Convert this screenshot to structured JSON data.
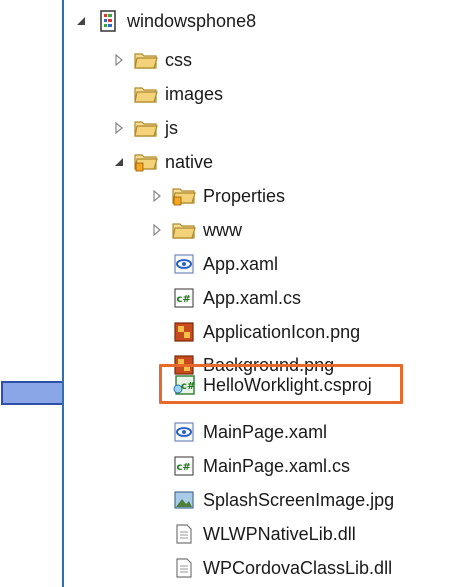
{
  "tree": {
    "root": {
      "label": "windowsphone8",
      "icon": "project-icon",
      "expanded": true
    },
    "items": [
      {
        "label": "css",
        "icon": "folder-icon",
        "level": 1,
        "toggle": "collapsed"
      },
      {
        "label": "images",
        "icon": "folder-icon",
        "level": 1,
        "toggle": "none"
      },
      {
        "label": "js",
        "icon": "folder-icon",
        "level": 1,
        "toggle": "collapsed"
      },
      {
        "label": "native",
        "icon": "package-folder-icon",
        "level": 1,
        "toggle": "expanded"
      },
      {
        "label": "Properties",
        "icon": "package-folder-icon",
        "level": 2,
        "toggle": "collapsed"
      },
      {
        "label": "www",
        "icon": "folder-icon",
        "level": 2,
        "toggle": "collapsed"
      },
      {
        "label": "App.xaml",
        "icon": "xaml-file-icon",
        "level": 2,
        "toggle": "none"
      },
      {
        "label": "App.xaml.cs",
        "icon": "csharp-file-icon",
        "level": 2,
        "toggle": "none"
      },
      {
        "label": "ApplicationIcon.png",
        "icon": "png-file-icon",
        "level": 2,
        "toggle": "none"
      },
      {
        "label": "Background.png",
        "icon": "png-file-icon",
        "level": 2,
        "toggle": "none"
      },
      {
        "label": "HelloWorklight.csproj",
        "icon": "csproj-file-icon",
        "level": 2,
        "toggle": "none",
        "highlighted": true
      },
      {
        "label": "MainPage.xaml",
        "icon": "xaml-file-icon",
        "level": 2,
        "toggle": "none"
      },
      {
        "label": "MainPage.xaml.cs",
        "icon": "csharp-file-icon",
        "level": 2,
        "toggle": "none"
      },
      {
        "label": "SplashScreenImage.jpg",
        "icon": "jpg-file-icon",
        "level": 2,
        "toggle": "none"
      },
      {
        "label": "WLWPNativeLib.dll",
        "icon": "dll-file-icon",
        "level": 2,
        "toggle": "none"
      },
      {
        "label": "WPCordovaClassLib.dll",
        "icon": "dll-file-icon",
        "level": 2,
        "toggle": "none"
      }
    ]
  },
  "colors": {
    "highlight_border": "#e86a2a",
    "arrow_fill": "#7f9ee0",
    "arrow_stroke": "#2e4fa8",
    "panel_border": "#2f6fb6",
    "folder_fill": "#f3d27a"
  },
  "annotation": {
    "arrow": "pointing-right-arrow-icon"
  }
}
